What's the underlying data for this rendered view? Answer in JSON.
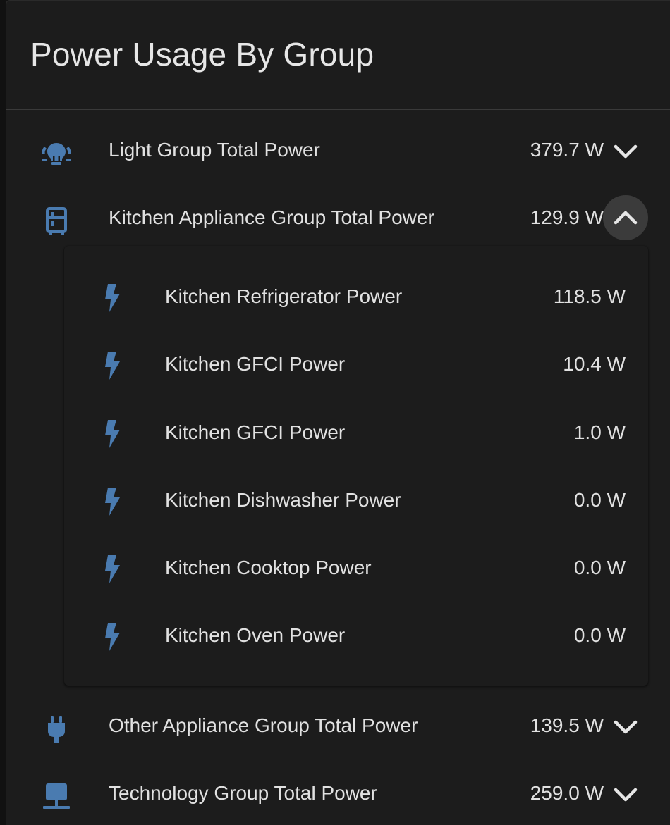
{
  "card": {
    "title": "Power Usage By Group"
  },
  "colors": {
    "icon": "#4a7bb0",
    "background": "#1c1c1c",
    "text": "#e1e1e1"
  },
  "groups": [
    {
      "label": "Light Group Total Power",
      "value": "379.7 W",
      "icon": "lightbulb-group-icon",
      "expanded": false
    },
    {
      "label": "Kitchen Appliance Group Total Power",
      "value": "129.9 W",
      "icon": "fridge-icon",
      "expanded": true,
      "children": [
        {
          "label": "Kitchen Refrigerator Power",
          "value": "118.5 W",
          "icon": "flash-icon"
        },
        {
          "label": "Kitchen GFCI Power",
          "value": "10.4 W",
          "icon": "flash-icon"
        },
        {
          "label": "Kitchen GFCI Power",
          "value": "1.0 W",
          "icon": "flash-icon"
        },
        {
          "label": "Kitchen Dishwasher Power",
          "value": "0.0 W",
          "icon": "flash-icon"
        },
        {
          "label": "Kitchen Cooktop Power",
          "value": "0.0 W",
          "icon": "flash-icon"
        },
        {
          "label": "Kitchen Oven Power",
          "value": "0.0 W",
          "icon": "flash-icon"
        }
      ]
    },
    {
      "label": "Other Appliance Group Total Power",
      "value": "139.5 W",
      "icon": "power-plug-icon",
      "expanded": false
    },
    {
      "label": "Technology Group Total Power",
      "value": "259.0 W",
      "icon": "monitor-network-icon",
      "expanded": false
    }
  ]
}
